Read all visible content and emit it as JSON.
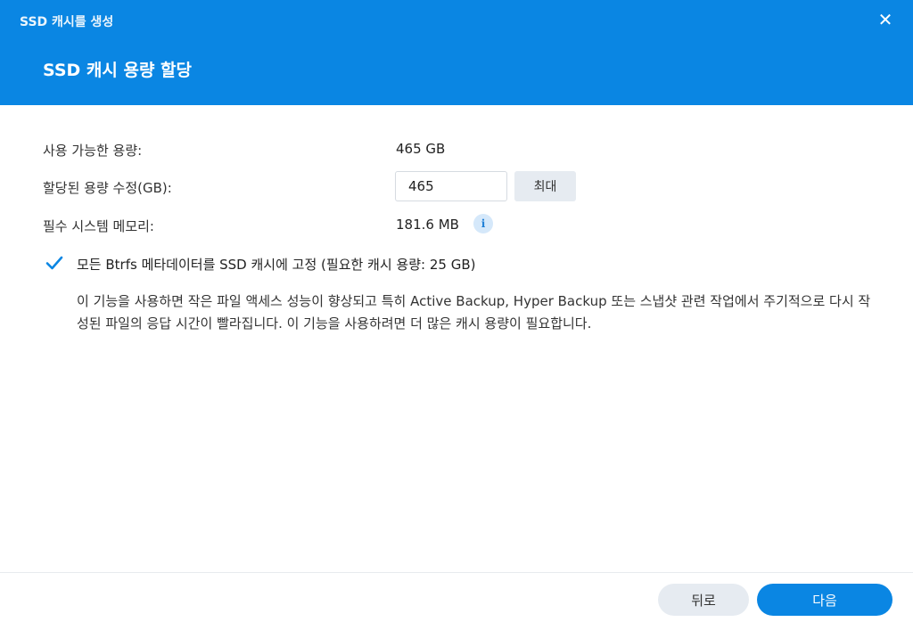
{
  "window": {
    "title": "SSD 캐시를 생성",
    "close_icon": "close-icon"
  },
  "step": {
    "title": "SSD 캐시 용량 할당"
  },
  "form": {
    "available_label": "사용 가능한 용량:",
    "available_value": "465 GB",
    "allocated_label": "할당된 용량 수정(GB):",
    "allocated_value": "465",
    "max_label": "최대",
    "memory_label": "필수 시스템 메모리:",
    "memory_value": "181.6 MB",
    "info_icon": "info-icon",
    "pin_checked": true,
    "pin_label": "모든 Btrfs 메타데이터를 SSD 캐시에 고정 (필요한 캐시 용량: 25 GB)",
    "description": "이 기능을 사용하면 작은 파일 액세스 성능이 향상되고 특히 Active Backup, Hyper Backup 또는 스냅샷 관련 작업에서 주기적으로 다시 작성된 파일의 응답 시간이 빨라집니다. 이 기능을 사용하려면 더 많은 캐시 용량이 필요합니다."
  },
  "footer": {
    "back_label": "뒤로",
    "next_label": "다음"
  },
  "colors": {
    "accent": "#0a86e3",
    "secondary_button": "#e6ebf1",
    "info_bg": "#d5e8fa"
  }
}
